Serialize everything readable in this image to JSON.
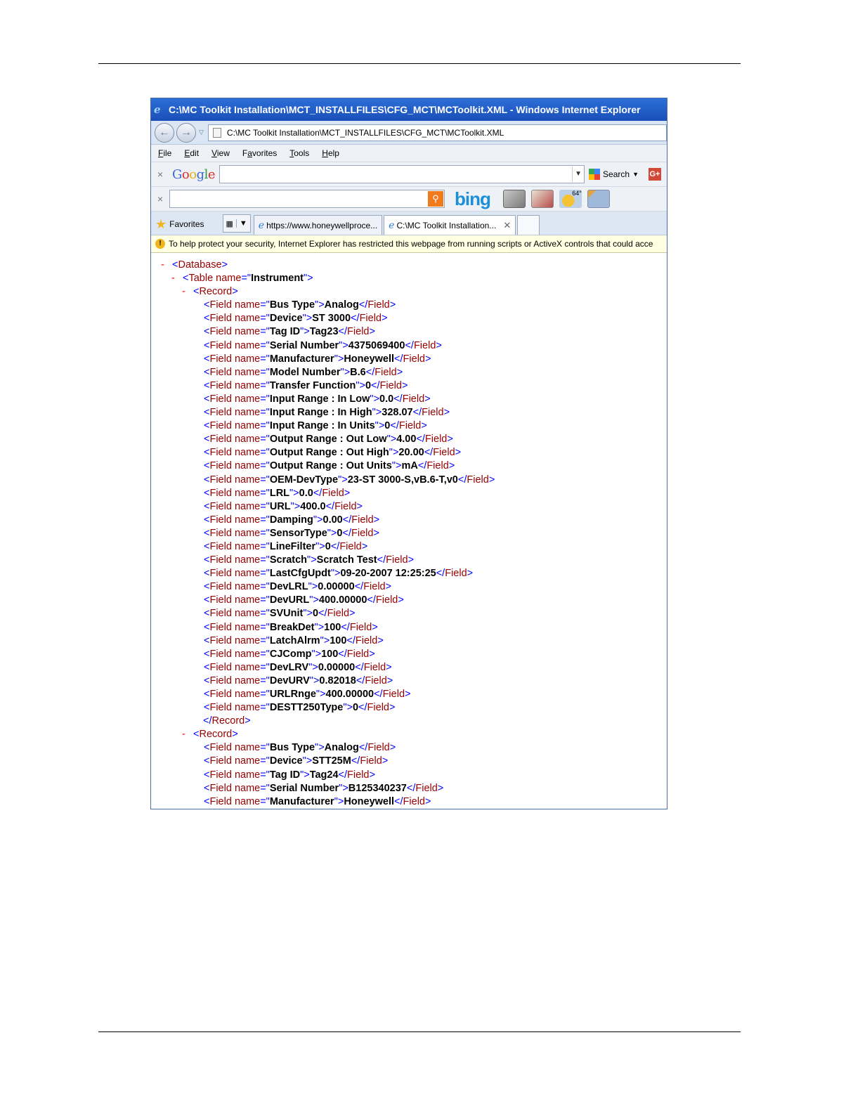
{
  "window": {
    "title": "C:\\MC Toolkit Installation\\MCT_INSTALLFILES\\CFG_MCT\\MCToolkit.XML - Windows Internet Explorer",
    "address": "C:\\MC Toolkit Installation\\MCT_INSTALLFILES\\CFG_MCT\\MCToolkit.XML"
  },
  "menu": [
    {
      "label": "File"
    },
    {
      "label": "Edit"
    },
    {
      "label": "View"
    },
    {
      "label": "Favorites"
    },
    {
      "label": "Tools"
    },
    {
      "label": "Help"
    }
  ],
  "google_toolbar": {
    "logo": "Google",
    "search_label": "Search",
    "close": "×",
    "plus": "G+"
  },
  "bing_toolbar": {
    "logo": "bing",
    "close": "×",
    "weather": "64°"
  },
  "favorites": {
    "label": "Favorites"
  },
  "tabs": [
    {
      "label": "https://www.honeywellproce...",
      "active": false
    },
    {
      "label": "C:\\MC Toolkit Installation...",
      "active": true
    }
  ],
  "infobar": {
    "text": "To help protect your security, Internet Explorer has restricted this webpage from running scripts or ActiveX controls that could acce"
  },
  "xml": {
    "root_tag": "Database",
    "table_name": "Instrument",
    "record_tag": "Record",
    "record1": [
      {
        "name": "Bus Type",
        "value": "Analog"
      },
      {
        "name": "Device",
        "value": "ST 3000"
      },
      {
        "name": "Tag ID",
        "value": "Tag23"
      },
      {
        "name": "Serial Number",
        "value": "4375069400"
      },
      {
        "name": "Manufacturer",
        "value": "Honeywell"
      },
      {
        "name": "Model Number",
        "value": "B.6"
      },
      {
        "name": "Transfer Function",
        "value": "0"
      },
      {
        "name": "Input Range : In Low",
        "value": "0.0"
      },
      {
        "name": "Input Range : In High",
        "value": "328.07"
      },
      {
        "name": "Input Range : In Units",
        "value": "0"
      },
      {
        "name": "Output Range : Out Low",
        "value": "4.00"
      },
      {
        "name": "Output Range : Out High",
        "value": "20.00"
      },
      {
        "name": "Output Range : Out Units",
        "value": "mA"
      },
      {
        "name": "OEM-DevType",
        "value": "23-ST 3000-S,vB.6-T,v0"
      },
      {
        "name": "LRL",
        "value": "0.0"
      },
      {
        "name": "URL",
        "value": "400.0"
      },
      {
        "name": "Damping",
        "value": "0.00"
      },
      {
        "name": "SensorType",
        "value": "0"
      },
      {
        "name": "LineFilter",
        "value": "0"
      },
      {
        "name": "Scratch",
        "value": "Scratch Test"
      },
      {
        "name": "LastCfgUpdt",
        "value": "09-20-2007 12:25:25"
      },
      {
        "name": "DevLRL",
        "value": "0.00000"
      },
      {
        "name": "DevURL",
        "value": "400.00000"
      },
      {
        "name": "SVUnit",
        "value": "0"
      },
      {
        "name": "BreakDet",
        "value": "100"
      },
      {
        "name": "LatchAlrm",
        "value": "100"
      },
      {
        "name": "CJComp",
        "value": "100"
      },
      {
        "name": "DevLRV",
        "value": "0.00000"
      },
      {
        "name": "DevURV",
        "value": "0.82018"
      },
      {
        "name": "URLRnge",
        "value": "400.00000"
      },
      {
        "name": "DESTT250Type",
        "value": "0"
      }
    ],
    "record2": [
      {
        "name": "Bus Type",
        "value": "Analog"
      },
      {
        "name": "Device",
        "value": "STT25M"
      },
      {
        "name": "Tag ID",
        "value": "Tag24"
      },
      {
        "name": "Serial Number",
        "value": "B125340237"
      },
      {
        "name": "Manufacturer",
        "value": "Honeywell"
      }
    ]
  }
}
